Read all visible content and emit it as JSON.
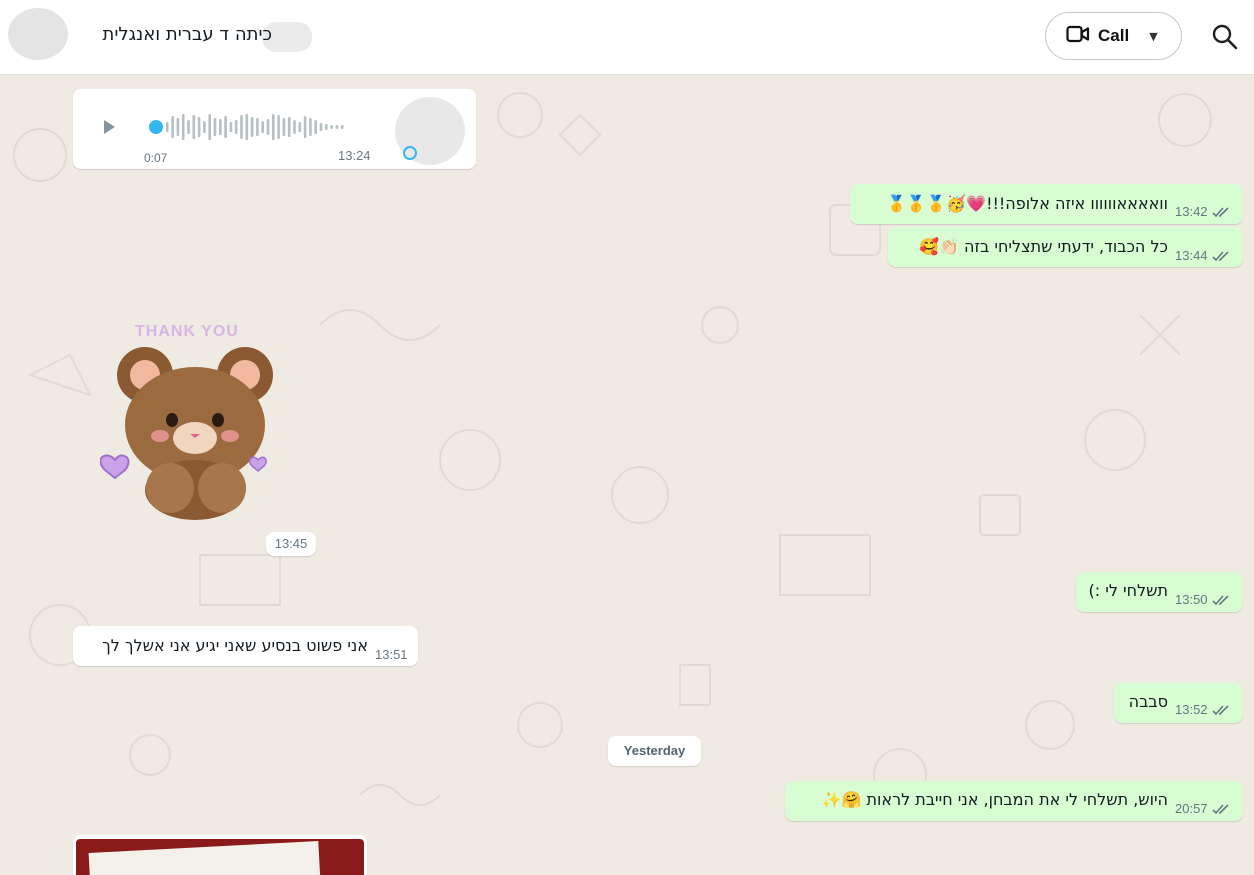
{
  "header": {
    "title": "כיתה ד עברית ואנגלית",
    "call_label": "Call",
    "icons": {
      "video": "video-camera-icon",
      "dropdown": "caret-down-icon",
      "search": "search-icon"
    }
  },
  "voice_message": {
    "duration": "0:07",
    "time": "13:24"
  },
  "messages": [
    {
      "direction": "out",
      "text": "וואאאאוווווו איזה אלופה!!!💗🥳🥇🥇🥇",
      "time": "13:42"
    },
    {
      "direction": "out",
      "text": "כל הכבוד, ידעתי שתצליחי בזה 👏🏻🥰",
      "time": "13:44"
    },
    {
      "direction": "out",
      "text": "תשלחי לי :)",
      "time": "13:50"
    },
    {
      "direction": "in",
      "text": "אני פשוט בנסיע שאני יגיע אני אשלך לך",
      "time": "13:51"
    },
    {
      "direction": "out",
      "text": "סבבה",
      "time": "13:52"
    },
    {
      "direction": "out",
      "text": "היוש, תשלחי לי את המבחן, אני חייבת לראות 🤗✨",
      "time": "20:57"
    }
  ],
  "sticker": {
    "caption": "THANK YOU",
    "time": "13:45"
  },
  "date_divider": "Yesterday",
  "colors": {
    "outgoing": "#d9fdd3",
    "incoming": "#ffffff",
    "background": "#efeae2",
    "voice_accent": "#34b7f1"
  }
}
